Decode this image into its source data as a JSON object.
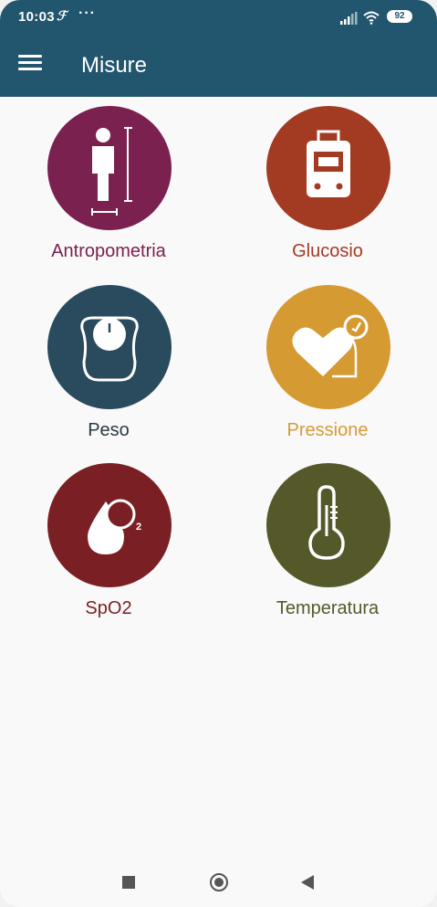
{
  "status_bar": {
    "time": "10:03",
    "dots": "···",
    "battery": "92"
  },
  "app_bar": {
    "title": "Misure",
    "menu_icon": "hamburger-menu-icon"
  },
  "tiles": [
    {
      "label": "Antropometria",
      "color": "#7b2150",
      "icon": "person-height-icon"
    },
    {
      "label": "Glucosio",
      "color": "#a23b22",
      "icon": "glucometer-icon"
    },
    {
      "label": "Peso",
      "color": "#2a4a5e",
      "icon": "scale-icon"
    },
    {
      "label": "Pressione",
      "color": "#d69a33",
      "icon": "heart-pressure-icon"
    },
    {
      "label": "SpO2",
      "color": "#7a1f24",
      "icon": "oxygen-drop-icon"
    },
    {
      "label": "Temperatura",
      "color": "#55592a",
      "icon": "thermometer-icon"
    }
  ],
  "nav_bar": {
    "recents_icon": "square-recents-icon",
    "home_icon": "circle-home-icon",
    "back_icon": "triangle-back-icon"
  },
  "colors": {
    "header": "#22556e",
    "background": "#f9f9f9"
  }
}
